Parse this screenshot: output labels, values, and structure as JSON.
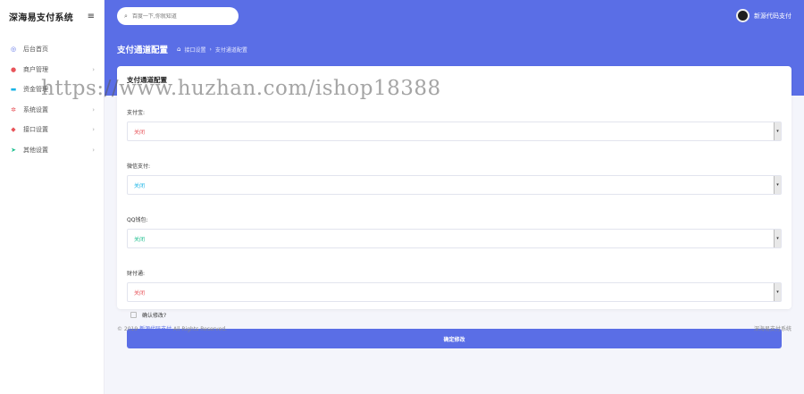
{
  "sidebar": {
    "title": "深海易支付系统",
    "toggle_icon": "menu-icon",
    "items": [
      {
        "label": "后台首页",
        "icon": "dashboard-icon",
        "glyph": "◎",
        "color": "#5a6ee6",
        "arrow": ""
      },
      {
        "label": "商户管理",
        "icon": "user-icon",
        "glyph": "●",
        "color": "#e8545a",
        "arrow": "›"
      },
      {
        "label": "资金管理",
        "icon": "wallet-icon",
        "glyph": "▬",
        "color": "#19b4e6",
        "arrow": "›"
      },
      {
        "label": "系统设置",
        "icon": "gear-icon",
        "glyph": "✲",
        "color": "#e8545a",
        "arrow": "›"
      },
      {
        "label": "接口设置",
        "icon": "plug-icon",
        "glyph": "◆",
        "color": "#e8545a",
        "arrow": "›"
      },
      {
        "label": "其他设置",
        "icon": "send-icon",
        "glyph": "➤",
        "color": "#1fbf8f",
        "arrow": "›"
      }
    ]
  },
  "header": {
    "search_placeholder": "百度一下,你就知道",
    "user_name": "新源代码支付",
    "page_title": "支付通道配置",
    "breadcrumb": [
      "接口设置",
      "支付通道配置"
    ]
  },
  "form": {
    "card_title": "支付通道配置",
    "fields": [
      {
        "label": "支付宝:",
        "value": "关闭",
        "color": "#e8545a"
      },
      {
        "label": "微信支付:",
        "value": "关闭",
        "color": "#19b4e6"
      },
      {
        "label": "QQ钱包:",
        "value": "关闭",
        "color": "#1fbf8f"
      },
      {
        "label": "财付通:",
        "value": "关闭",
        "color": "#e8545a"
      }
    ],
    "confirm_label": "确认修改?",
    "submit_label": "确定修改"
  },
  "footer": {
    "copyright": "© 2019",
    "brand_link": "新源代码支付",
    "rights": "All Rights Reserved.",
    "right_text": "深海易支付系统"
  },
  "watermark": "https://www.huzhan.com/ishop18388",
  "colors": {
    "accent": "#5a6ee6"
  }
}
